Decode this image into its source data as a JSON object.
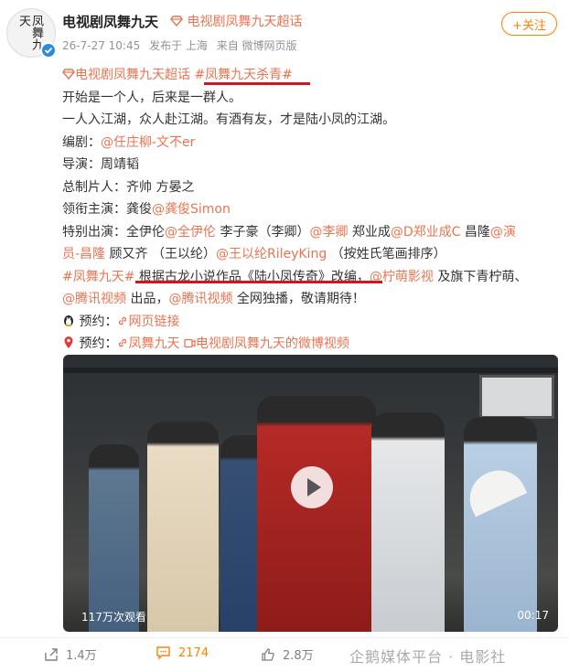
{
  "header": {
    "name": "电视剧凤舞九天",
    "super_topic": "电视剧凤舞九天超话",
    "time": "26-7-27 10:45",
    "posted_from": "发布于 上海",
    "source": "来自 微博网页版",
    "follow_label": "+关注",
    "avatar_text": "凤舞九天"
  },
  "post": {
    "line1_topic": "电视剧凤舞九天超话",
    "line1_tag": "#凤舞九天杀青#",
    "line2": "开始是一个人，后来是一群人。",
    "line3": "一人入江湖，众人赴江湖。有酒有友，才是陆小凤的江湖。",
    "screenwriter_label": "编剧：",
    "screenwriter": "@任庄柳-文不er",
    "director": "导演：周靖韬",
    "producer": "总制片人：齐帅 方晏之",
    "lead_label": "领衔主演：龚俊",
    "lead_at": "@龚俊Simon",
    "special_label": "特别出演：全伊伦",
    "special_at1": "@全伊伦",
    "special_mid1": " 李子豪（李卿）",
    "special_at2": "@李卿",
    "special_mid2": " 郑业成",
    "special_at3": "@D郑业成C",
    "special_mid3": " 昌隆",
    "special_at4a": "@演",
    "special_at4b": "员-昌隆",
    "special_mid4": " 顾又齐 （王以纶）",
    "special_at5": "@王以纶RileyKing",
    "special_end": " （按姓氏笔画排序）",
    "hashtag": "#凤舞九天#",
    "adapted": " 根据古龙小说作品《陆小凤传奇》改编，",
    "company_at": "@柠萌影视",
    "company_rest": " 及旗下青柠萌、",
    "tencent_at1": "@腾讯视频",
    "produce_text": " 出品，",
    "tencent_at2": "@腾讯视频",
    "exclusive_text": " 全网独播，敬请期待！",
    "reserve1_label": "预约：",
    "reserve1_link": "网页链接",
    "reserve2_label": "预约：",
    "reserve2_link1": "凤舞九天",
    "reserve2_link2": "电视剧凤舞九天的微博视频"
  },
  "video": {
    "views": "117万次观看",
    "duration": "00:17"
  },
  "actions": {
    "repost_count": "1.4万",
    "comment_count": "2174",
    "like_count": "2.8万",
    "watermark": "企鹅媒体平台 · 电影社"
  },
  "colors": {
    "link": "#eb7350",
    "underline": "#d4151e",
    "follow": "#ff8200",
    "verified": "#2b8cd9"
  }
}
